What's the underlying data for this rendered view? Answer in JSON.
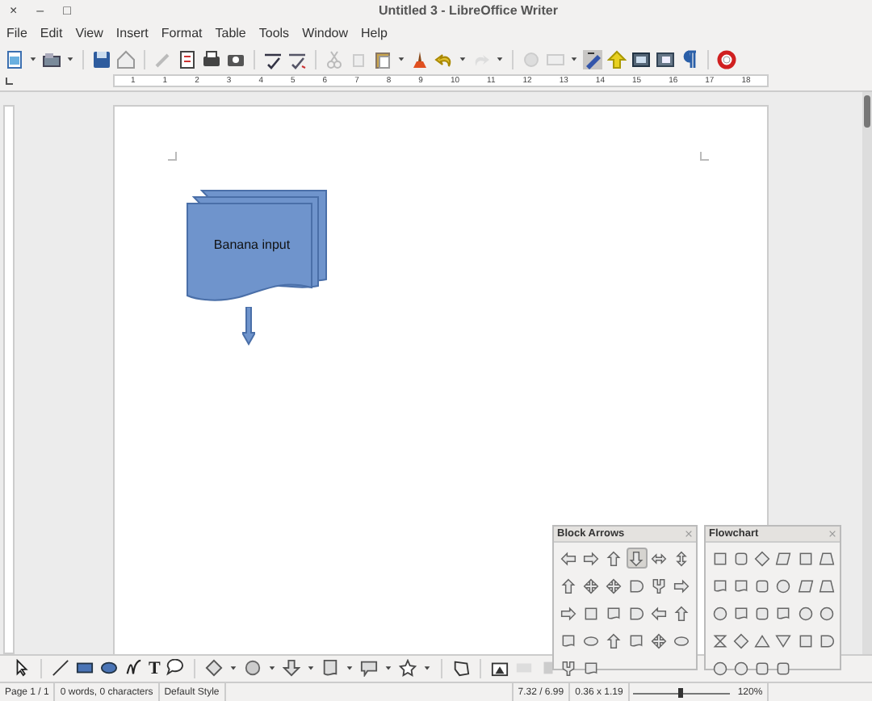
{
  "window": {
    "title": "Untitled 3 - LibreOffice Writer",
    "controls": [
      "×",
      "–",
      "□"
    ]
  },
  "menu": [
    "File",
    "Edit",
    "View",
    "Insert",
    "Format",
    "Table",
    "Tools",
    "Window",
    "Help"
  ],
  "ruler": {
    "labels": [
      "1",
      "1",
      "2",
      "3",
      "4",
      "5",
      "6",
      "7",
      "8",
      "9",
      "10",
      "11",
      "12",
      "13",
      "14",
      "15",
      "16",
      "17",
      "18"
    ]
  },
  "document": {
    "shape": {
      "text": "Banana input"
    }
  },
  "drawing_toolbar": {
    "text_tool": "T"
  },
  "palettes": [
    {
      "title": "Block Arrows",
      "items": [
        {
          "selected": false
        },
        {
          "selected": false
        },
        {
          "selected": false
        },
        {
          "selected": true
        },
        {
          "selected": false
        },
        {
          "selected": false
        },
        {
          "selected": false
        },
        {
          "selected": false
        },
        {
          "selected": false
        },
        {
          "selected": false
        },
        {
          "selected": false
        },
        {
          "selected": false
        },
        {
          "selected": false
        },
        {
          "selected": false
        },
        {
          "selected": false
        },
        {
          "selected": false
        },
        {
          "selected": false
        },
        {
          "selected": false
        },
        {
          "selected": false
        },
        {
          "selected": false
        },
        {
          "selected": false
        },
        {
          "selected": false
        },
        {
          "selected": false
        },
        {
          "selected": false
        },
        {
          "selected": false
        },
        {
          "selected": false
        }
      ]
    },
    {
      "title": "Flowchart",
      "items": [
        {
          "selected": false
        },
        {
          "selected": false
        },
        {
          "selected": false
        },
        {
          "selected": false
        },
        {
          "selected": false
        },
        {
          "selected": false
        },
        {
          "selected": false
        },
        {
          "selected": false
        },
        {
          "selected": false
        },
        {
          "selected": false
        },
        {
          "selected": false
        },
        {
          "selected": false
        },
        {
          "selected": false
        },
        {
          "selected": false
        },
        {
          "selected": false
        },
        {
          "selected": false
        },
        {
          "selected": false
        },
        {
          "selected": false
        },
        {
          "selected": false
        },
        {
          "selected": false
        },
        {
          "selected": false
        },
        {
          "selected": false
        },
        {
          "selected": false
        },
        {
          "selected": false
        },
        {
          "selected": false
        },
        {
          "selected": false
        },
        {
          "selected": false
        },
        {
          "selected": false
        }
      ]
    }
  ],
  "zoom": {
    "level": 0.5
  },
  "status_bar": [
    "Page 1 / 1",
    "0 words, 0 characters",
    "Default Style",
    "7.32 / 6.99",
    "0.36 x 1.19",
    "120%"
  ]
}
